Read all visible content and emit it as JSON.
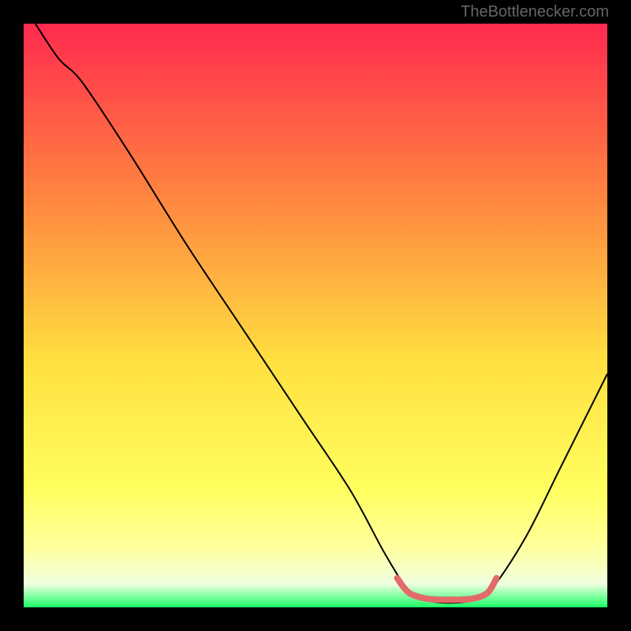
{
  "watermark": "TheBottlenecker.com",
  "chart_data": {
    "type": "line",
    "title": "",
    "xlabel": "",
    "ylabel": "",
    "xlim": [
      0,
      100
    ],
    "ylim": [
      0,
      100
    ],
    "background_gradient": {
      "top": "#ff2a4f",
      "mid1": "#ff8040",
      "mid2": "#ffe040",
      "mid3": "#ffff60",
      "lowStart": "#ffffa0",
      "lowEnd": "#f0ffe0",
      "bottom": "#1aff66"
    },
    "curve": {
      "name": "bottleneck-curve",
      "color": "#000000",
      "width": 2,
      "points": [
        {
          "x": 2,
          "y": 100
        },
        {
          "x": 6,
          "y": 94
        },
        {
          "x": 10,
          "y": 90
        },
        {
          "x": 18,
          "y": 78
        },
        {
          "x": 28,
          "y": 62
        },
        {
          "x": 38,
          "y": 47
        },
        {
          "x": 48,
          "y": 32
        },
        {
          "x": 56,
          "y": 20
        },
        {
          "x": 62,
          "y": 9
        },
        {
          "x": 66,
          "y": 3
        },
        {
          "x": 70,
          "y": 1
        },
        {
          "x": 76,
          "y": 1
        },
        {
          "x": 80,
          "y": 3
        },
        {
          "x": 86,
          "y": 12
        },
        {
          "x": 92,
          "y": 24
        },
        {
          "x": 100,
          "y": 40
        }
      ]
    },
    "highlight": {
      "name": "optimal-range",
      "color": "#e46a6a",
      "width": 8,
      "points": [
        {
          "x": 64,
          "y": 5
        },
        {
          "x": 66,
          "y": 2.5
        },
        {
          "x": 69,
          "y": 1.5
        },
        {
          "x": 73,
          "y": 1.3
        },
        {
          "x": 77,
          "y": 1.5
        },
        {
          "x": 79.5,
          "y": 2.5
        },
        {
          "x": 81,
          "y": 5
        }
      ]
    }
  }
}
